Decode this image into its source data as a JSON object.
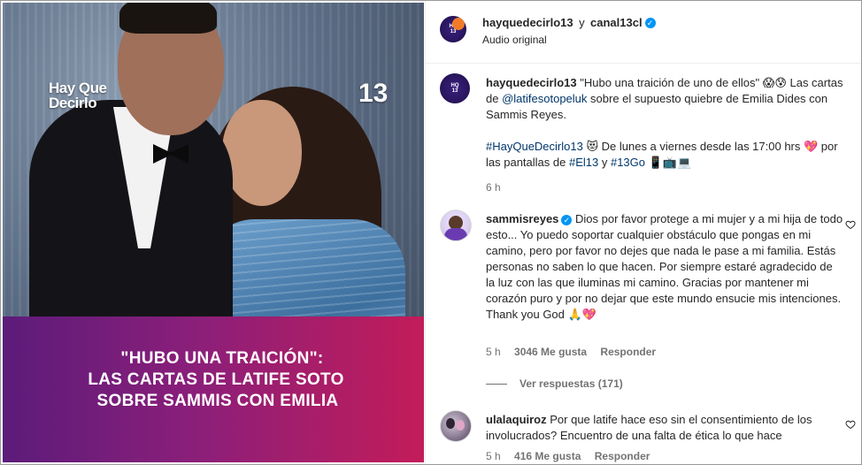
{
  "media": {
    "logo_line1": "Hay Que",
    "logo_line2": "Decirlo",
    "channel_mark": "13",
    "headline_line1": "\"HUBO UNA TRAICIÓN\":",
    "headline_line2": "LAS CARTAS DE LATIFE SOTO",
    "headline_line3": "SOBRE SAMMIS CON EMILIA"
  },
  "header": {
    "author": "hayquedecirlo13",
    "joiner": "y",
    "coauthor": "canal13cl",
    "subtitle": "Audio original",
    "avatar_icon": "hayquedecirlo-avatar"
  },
  "caption": {
    "author": "hayquedecirlo13",
    "text1": "\"Hubo una traición de uno de ellos\" 😱😰 Las cartas de",
    "mention": "@latifesotopeluk",
    "text2": "sobre el supuesto quiebre de Emilia Dides con Sammis Reyes.",
    "hashtag1": "#HayQueDecirlo13",
    "text3": "😻 De lunes a viernes desde las 17:00 hrs 💖 por las pantallas de",
    "hashtag2": "#El13",
    "joiner": "y",
    "hashtag3": "#13Go",
    "text4": "📱📺💻",
    "time": "6 h"
  },
  "comments": [
    {
      "author": "sammisreyes",
      "verified": true,
      "text": "Dios por favor protege a mi mujer y a mi hija de todo esto... Yo puedo soportar cualquier obstáculo que pongas en mi camino, pero por favor no dejes que nada le pase a mi familia. Estás personas no saben lo que hacen. Por siempre estaré agradecido de la luz con las que iluminas mi camino. Gracias por mantener mi corazón puro y por no dejar que este mundo ensucie mis intenciones. Thank you God 🙏💖",
      "time": "5 h",
      "likes": "3046 Me gusta",
      "reply": "Responder",
      "view_replies": "Ver respuestas (171)"
    },
    {
      "author": "ulalaquiroz",
      "verified": false,
      "text": "Por que latife hace eso sin el consentimiento de los involucrados? Encuentro de una falta de ética lo que hace",
      "time": "5 h",
      "likes": "416 Me gusta",
      "reply": "Responder"
    }
  ],
  "colors": {
    "verified": "#0095f6",
    "link": "#00376b",
    "meta": "#737373",
    "band_start": "#5c1b7a",
    "band_end": "#c31c5a"
  }
}
